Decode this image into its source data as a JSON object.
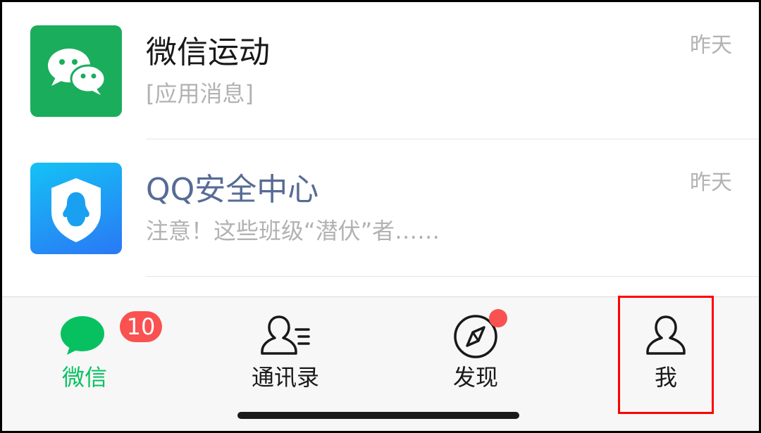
{
  "chats": [
    {
      "name": "微信运动",
      "preview": "[应用消息]",
      "time": "昨天",
      "avatar_icon": "wechat-logo-icon",
      "avatar_color": "#1aad5c"
    },
    {
      "name": "QQ安全中心",
      "preview": "注意！这些班级“潜伏”者……",
      "time": "昨天",
      "avatar_icon": "qq-shield-icon",
      "avatar_color": "#1e90ff"
    }
  ],
  "tabbar": {
    "tabs": [
      {
        "label": "微信",
        "icon": "chat-bubbles-icon",
        "badge": "10",
        "active": true
      },
      {
        "label": "通讯录",
        "icon": "contacts-icon"
      },
      {
        "label": "发现",
        "icon": "compass-icon",
        "red_dot": true
      },
      {
        "label": "我",
        "icon": "person-icon",
        "highlighted": true
      }
    ],
    "active_color": "#07c160",
    "badge_color": "#fa5151",
    "highlight_color": "#ff0000"
  }
}
